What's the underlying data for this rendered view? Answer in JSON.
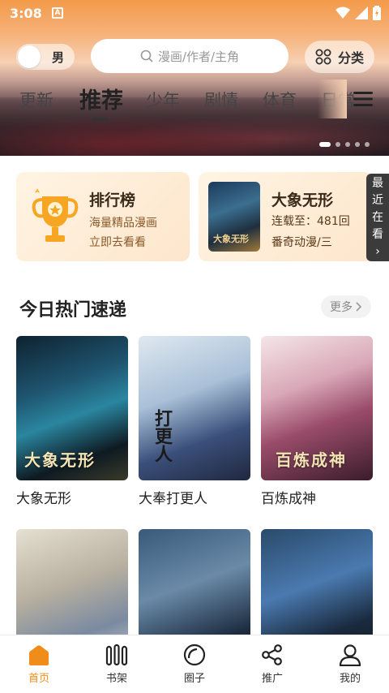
{
  "status_bar": {
    "time": "3:08",
    "notification_letter": "A"
  },
  "header": {
    "gender_toggle": {
      "label": "男"
    },
    "search": {
      "placeholder": "漫画/作者/主角"
    },
    "category_button": {
      "label": "分类"
    },
    "tabs": [
      {
        "label": "更新",
        "active": false
      },
      {
        "label": "推荐",
        "active": true
      },
      {
        "label": "少年",
        "active": false
      },
      {
        "label": "剧情",
        "active": false
      },
      {
        "label": "体育",
        "active": false
      },
      {
        "label": "日常",
        "active": false
      }
    ],
    "carousel": {
      "count": 5,
      "active_index": 0
    }
  },
  "cards": {
    "ranking": {
      "title": "排行榜",
      "line1": "海量精品漫画",
      "line2": "立即去看看"
    },
    "recent": {
      "title": "大象无形",
      "line1": "连载至：481回",
      "line2": "番奇动漫/三",
      "cover_text": "大象无形"
    }
  },
  "recent_tab": {
    "label": [
      "最",
      "近",
      "在",
      "看"
    ],
    "arrow": "›"
  },
  "section": {
    "title": "今日热门速递",
    "more_label": "更多"
  },
  "comics": [
    {
      "title": "大象无形",
      "cover_text": "大象无形"
    },
    {
      "title": "大奉打更人",
      "cover_text": "打更人"
    },
    {
      "title": "百炼成神",
      "cover_text": "百炼成神"
    },
    {
      "title": "",
      "cover_text": ""
    },
    {
      "title": "",
      "cover_text": ""
    },
    {
      "title": "",
      "cover_text": ""
    }
  ],
  "bottom_nav": [
    {
      "label": "首页",
      "icon": "home-icon",
      "active": true
    },
    {
      "label": "书架",
      "icon": "bookshelf-icon",
      "active": false
    },
    {
      "label": "圈子",
      "icon": "circle-icon",
      "active": false
    },
    {
      "label": "推广",
      "icon": "share-icon",
      "active": false
    },
    {
      "label": "我的",
      "icon": "user-icon",
      "active": false
    }
  ],
  "colors": {
    "accent": "#f08c1a",
    "tab_text": "#444444",
    "card_bg": "#fde6cc"
  }
}
